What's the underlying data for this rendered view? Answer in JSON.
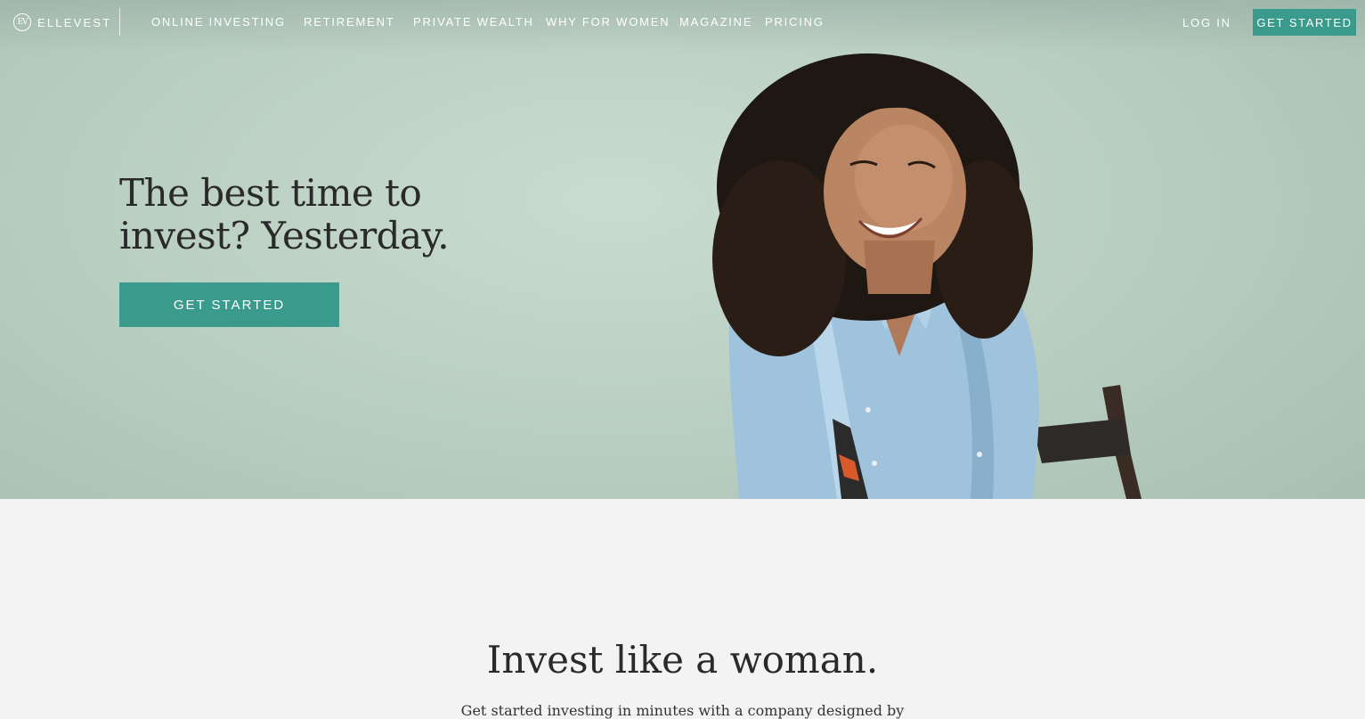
{
  "brand": {
    "logo_mark": "EV",
    "name": "ELLEVEST"
  },
  "nav": {
    "links": [
      {
        "label": "ONLINE INVESTING"
      },
      {
        "label": "RETIREMENT"
      },
      {
        "label": "PRIVATE WEALTH"
      },
      {
        "label": "WHY FOR WOMEN"
      },
      {
        "label": "MAGAZINE"
      },
      {
        "label": "PRICING"
      }
    ],
    "login": "LOG IN",
    "cta": "GET STARTED"
  },
  "hero": {
    "headline_line1": "The best time to",
    "headline_line2": "invest? Yesterday.",
    "cta": "GET STARTED",
    "image_subject": "smiling woman in denim shirt"
  },
  "section": {
    "title": "Invest like a woman.",
    "subtitle": "Get started investing in minutes with a company designed by"
  },
  "colors": {
    "accent": "#3a9a8c",
    "hero_bg": "#bcd1c4",
    "page_bg": "#f3f3f3",
    "text_dark": "#2a2a2a"
  }
}
